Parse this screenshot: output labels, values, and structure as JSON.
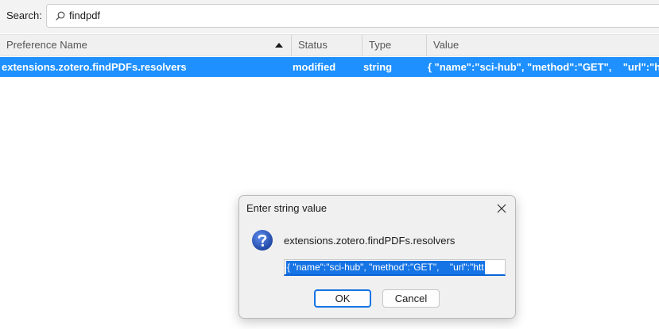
{
  "search": {
    "label": "Search:",
    "value": "findpdf",
    "icon": "search-icon"
  },
  "table": {
    "columns": [
      {
        "label": "Preference Name",
        "sorted": "ascending"
      },
      {
        "label": "Status"
      },
      {
        "label": "Type"
      },
      {
        "label": "Value"
      }
    ],
    "selected_row": {
      "name": "extensions.zotero.findPDFs.resolvers",
      "status": "modified",
      "type": "string",
      "value": "{ \"name\":\"sci-hub\", \"method\":\"GET\",    \"url\":\"ht"
    }
  },
  "dialog": {
    "title": "Enter string value",
    "message": "extensions.zotero.findPDFs.resolvers",
    "input_value": "{ \"name\":\"sci-hub\", \"method\":\"GET\",    \"url\":\"htt",
    "ok_label": "OK",
    "cancel_label": "Cancel",
    "icon": "question-icon"
  },
  "colors": {
    "selection": "#1e90ff",
    "accent": "#1674e4",
    "header_bg": "#f0f0f0"
  }
}
